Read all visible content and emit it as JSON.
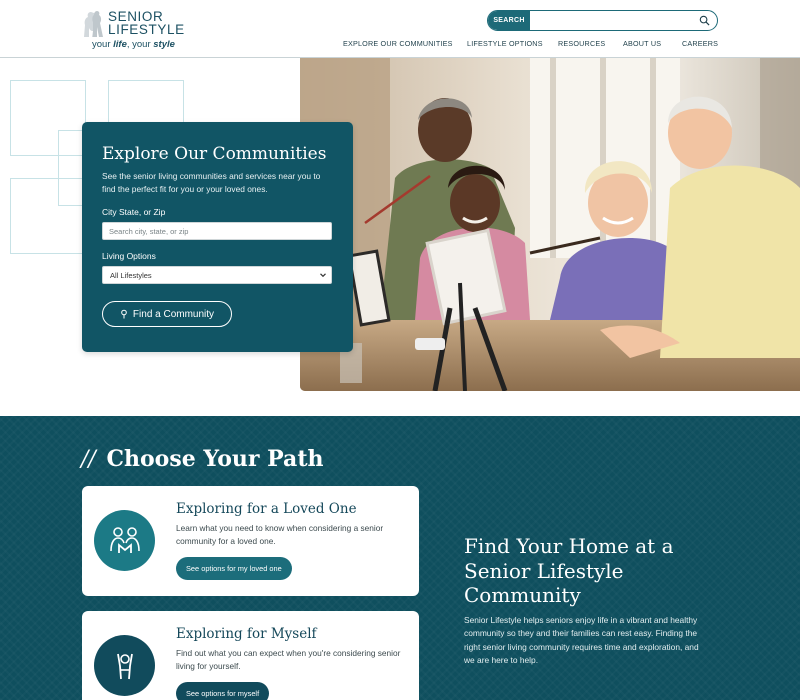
{
  "header": {
    "logo_line1": "SENIOR",
    "logo_line2": "LIFESTYLE",
    "tagline_your1": "your ",
    "tagline_life": "life",
    "tagline_comma": ", your ",
    "tagline_style": "style",
    "search_button": "SEARCH",
    "search_placeholder": "",
    "nav": [
      "EXPLORE OUR COMMUNITIES",
      "LIFESTYLE OPTIONS",
      "RESOURCES",
      "ABOUT US",
      "CAREERS"
    ]
  },
  "hero": {
    "card_title": "Explore Our Communities",
    "card_desc": "See the senior living communities and services near you to find the perfect fit for you or your loved ones.",
    "location_label": "City State, or Zip",
    "location_placeholder": "Search city, state, or zip",
    "living_label": "Living Options",
    "living_selected": "All Lifestyles",
    "find_button": "Find a Community"
  },
  "path": {
    "title": "Choose Your Path",
    "title_slash": "//",
    "cards": [
      {
        "title": "Exploring for a Loved One",
        "desc": "Learn what you need to know when considering a senior community for a loved one.",
        "button": "See options for my loved one"
      },
      {
        "title": "Exploring for Myself",
        "desc": "Find out what you can expect when you're considering senior living for yourself.",
        "button": "See options for myself"
      }
    ],
    "find_title": "Find Your Home at a Senior Lifestyle Community",
    "find_desc": "Senior Lifestyle helps seniors enjoy life in a vibrant and healthy community so they and their families can rest easy. Finding the right senior living community requires time and exploration, and we are here to help."
  },
  "colors": {
    "brand_teal": "#115565",
    "accent_teal": "#1c7a86",
    "section_bg": "#0f4f5e"
  },
  "icons": [
    "logo-mark-icon",
    "search-icon",
    "pin-icon",
    "chevron-down-icon",
    "family-icon",
    "person-waving-icon"
  ]
}
